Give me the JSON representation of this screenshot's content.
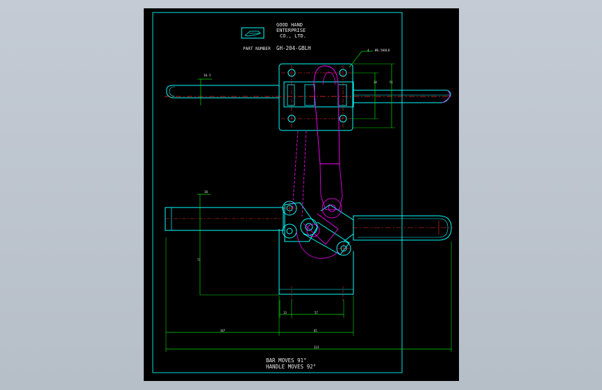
{
  "title_block": {
    "company_line1": "GOOD HAND",
    "company_line2": "ENTERPRISE",
    "company_line3": "CO., LTD.",
    "part_number_label": "PART NUMBER",
    "part_number": "GH-204-GBLH",
    "logo_text": "GOOD HAND"
  },
  "notes": {
    "bar_moves": "BAR MOVES 91°",
    "handle_moves": "HANDLE MOVES 92°"
  },
  "dimensions": {
    "hole_callout": "4 - Ø6.5HOLD",
    "top_bar_height": "16.5",
    "base_mount_h1": "34",
    "base_mount_h2": "51",
    "side_bar_height": "16",
    "overall_height": "71",
    "hole_gap_small": "13",
    "hole_span": "57",
    "reach": "107",
    "base_length": "65",
    "overall_length": "323"
  },
  "colors": {
    "sheet_border": "#00e5e5",
    "outline": "#00ffff",
    "dimension": "#00e000",
    "centerline": "#ff3030",
    "open_position": "#ff00ff",
    "text": "#e8e8e8"
  }
}
